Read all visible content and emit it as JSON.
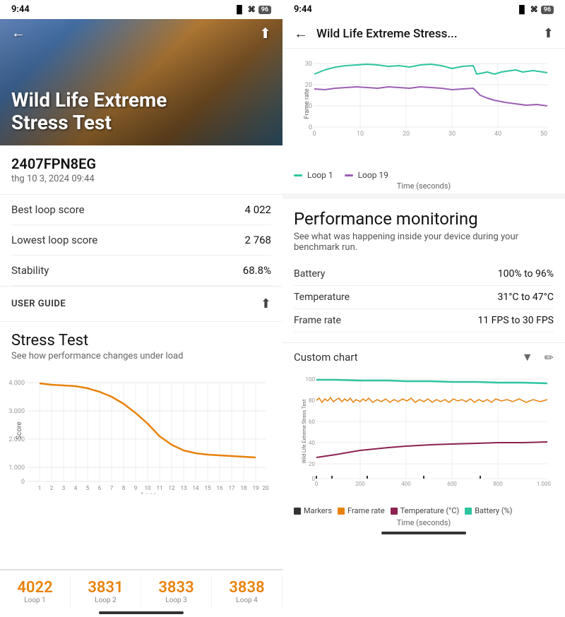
{
  "left": {
    "status_time": "9:44",
    "nav_back": "←",
    "nav_share": "⬆",
    "hero_title_line1": "Wild Life Extreme",
    "hero_title_line2": "Stress Test",
    "device_id": "2407FPN8EG",
    "date": "thg 10 3, 2024 09:44",
    "stats": [
      {
        "label": "Best loop score",
        "value": "4 022"
      },
      {
        "label": "Lowest loop score",
        "value": "2 768"
      },
      {
        "label": "Stability",
        "value": "68.8%"
      }
    ],
    "user_guide_label": "USER GUIDE",
    "stress_title": "Stress Test",
    "stress_subtitle": "See how performance changes under load",
    "loop_scores": [
      {
        "score": "4022",
        "label": "Loop 1"
      },
      {
        "score": "3831",
        "label": "Loop 2"
      },
      {
        "score": "3833",
        "label": "Loop 3"
      },
      {
        "score": "3838",
        "label": "Loop 4"
      }
    ]
  },
  "right": {
    "status_time": "9:44",
    "nav_title": "Wild Life Extreme Stress...",
    "frame_chart": {
      "y_label": "Frame rate",
      "x_label": "Time (seconds)",
      "legend": [
        {
          "label": "Loop 1",
          "color": "#2ec4a0"
        },
        {
          "label": "Loop 19",
          "color": "#9c5fb5"
        }
      ]
    },
    "perf_title": "Performance monitoring",
    "perf_subtitle": "See what was happening inside your device during your benchmark run.",
    "perf_rows": [
      {
        "label": "Battery",
        "value": "100% to 96%"
      },
      {
        "label": "Temperature",
        "value": "31°C to 47°C"
      },
      {
        "label": "Frame rate",
        "value": "11 FPS to 30 FPS"
      }
    ],
    "custom_chart_label": "Custom chart",
    "custom_chart_legend": [
      {
        "label": "Markers",
        "color": "#333"
      },
      {
        "label": "Frame rate",
        "color": "#e8820c"
      },
      {
        "label": "Temperature (°C)",
        "color": "#8b2252"
      },
      {
        "label": "Battery (%)",
        "color": "#2ec4a0"
      }
    ],
    "custom_chart_x_label": "Time (seconds)"
  }
}
